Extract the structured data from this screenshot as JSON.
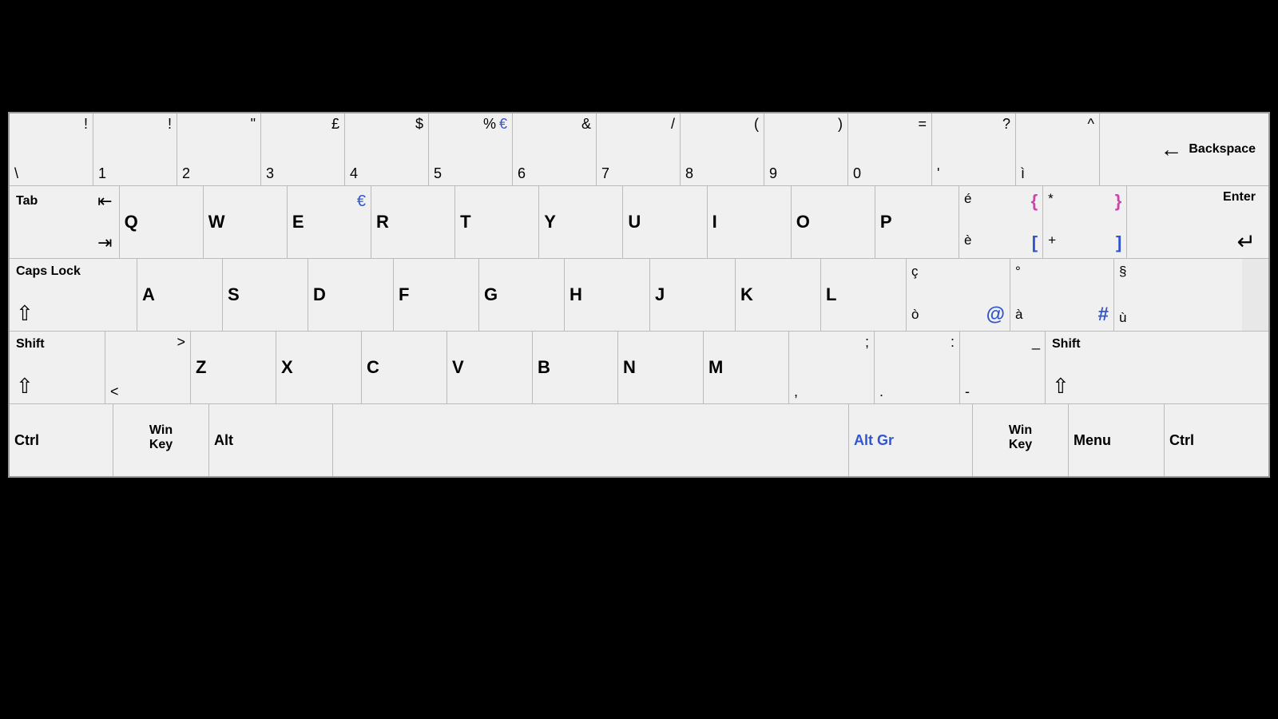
{
  "keyboard": {
    "rows": {
      "number": [
        {
          "top": "!",
          "bottom": "\\",
          "width": "num-key"
        },
        {
          "top": "!",
          "bottom": "1",
          "width": "num-key"
        },
        {
          "top": "\"",
          "bottom": "2",
          "width": "num-key"
        },
        {
          "top": "£",
          "bottom": "3",
          "width": "num-key"
        },
        {
          "top": "$",
          "bottom": "4",
          "width": "num-key"
        },
        {
          "top": "% €",
          "bottom": "5",
          "width": "num-key",
          "special": "euro5"
        },
        {
          "top": "&",
          "bottom": "6",
          "width": "num-key"
        },
        {
          "top": "/",
          "bottom": "7",
          "width": "num-key"
        },
        {
          "top": "(",
          "bottom": "8",
          "width": "num-key"
        },
        {
          "top": ")",
          "bottom": "9",
          "width": "num-key"
        },
        {
          "top": "=",
          "bottom": "0",
          "width": "num-key"
        },
        {
          "top": "?",
          "bottom": "'",
          "width": "num-key"
        },
        {
          "top": "^",
          "bottom": "ì",
          "width": "num-key"
        },
        {
          "label": "Backspace",
          "width": "backspace-key"
        }
      ],
      "tab": [
        {
          "label": "Tab",
          "width": "tab-key"
        },
        {
          "letter": "Q",
          "width": "letter-key"
        },
        {
          "letter": "W",
          "width": "letter-key"
        },
        {
          "letter": "E",
          "euro": true,
          "width": "letter-key"
        },
        {
          "letter": "R",
          "width": "letter-key"
        },
        {
          "letter": "T",
          "width": "letter-key"
        },
        {
          "letter": "Y",
          "width": "letter-key"
        },
        {
          "letter": "U",
          "width": "letter-key"
        },
        {
          "letter": "I",
          "width": "letter-key"
        },
        {
          "letter": "O",
          "width": "letter-key"
        },
        {
          "letter": "P",
          "width": "letter-key"
        },
        {
          "special": "bracket-left",
          "width": "letter-key"
        },
        {
          "special": "bracket-right",
          "width": "letter-key"
        },
        {
          "label": "Enter",
          "width": "enter-key"
        }
      ],
      "caps": [
        {
          "label": "Caps Lock",
          "width": "caps-key"
        },
        {
          "letter": "A",
          "width": "caps-letter"
        },
        {
          "letter": "S",
          "width": "caps-letter"
        },
        {
          "letter": "D",
          "width": "caps-letter"
        },
        {
          "letter": "F",
          "width": "caps-letter"
        },
        {
          "letter": "G",
          "width": "caps-letter"
        },
        {
          "letter": "H",
          "width": "caps-letter"
        },
        {
          "letter": "J",
          "width": "caps-letter"
        },
        {
          "letter": "K",
          "width": "caps-letter"
        },
        {
          "letter": "L",
          "width": "caps-letter"
        },
        {
          "special": "c-cedilla",
          "width": "ç-key"
        },
        {
          "special": "hash",
          "width": "hash-key"
        },
        {
          "special": "section",
          "width": "section-key"
        }
      ],
      "shift": [
        {
          "label": "Shift",
          "arrow": true,
          "width": "shift-left"
        },
        {
          "special": "angle",
          "width": "angle-key"
        },
        {
          "letter": "Z",
          "width": "shift-letter"
        },
        {
          "letter": "X",
          "width": "shift-letter"
        },
        {
          "letter": "C",
          "width": "shift-letter"
        },
        {
          "letter": "V",
          "width": "shift-letter"
        },
        {
          "letter": "B",
          "width": "shift-letter"
        },
        {
          "letter": "N",
          "width": "shift-letter"
        },
        {
          "letter": "M",
          "width": "shift-letter"
        },
        {
          "special": "semicolon",
          "width": "semi-key"
        },
        {
          "special": "colon",
          "width": "colon-key"
        },
        {
          "special": "dash",
          "width": "dash-key"
        },
        {
          "label": "Shift",
          "arrow": true,
          "width": "shift-right"
        }
      ],
      "bottom": [
        {
          "label": "Ctrl",
          "width": "ctrl-key"
        },
        {
          "label": "Win\nKey",
          "width": "win-key"
        },
        {
          "label": "Alt",
          "width": "alt-key"
        },
        {
          "label": "",
          "width": "space-key"
        },
        {
          "label": "Alt Gr",
          "blue": true,
          "width": "altgr-key"
        },
        {
          "label": "Win\nKey",
          "width": "win2-key"
        },
        {
          "label": "Menu",
          "width": "menu-key"
        },
        {
          "label": "Ctrl",
          "width": "ctrl2-key"
        }
      ]
    }
  }
}
